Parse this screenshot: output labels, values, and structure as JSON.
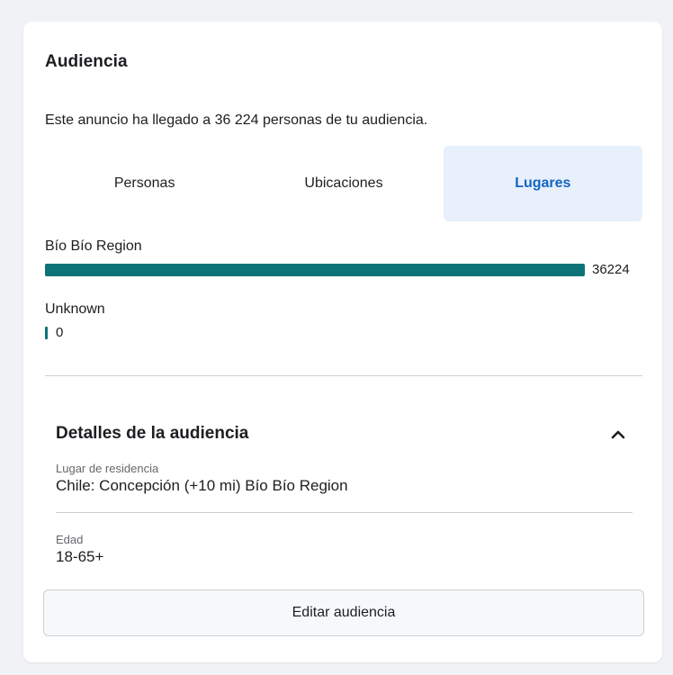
{
  "audience": {
    "title": "Audiencia",
    "reach_text": "Este anuncio ha llegado a 36 224 personas de tu audiencia."
  },
  "tabs": [
    {
      "label": "Personas",
      "active": false
    },
    {
      "label": "Ubicaciones",
      "active": false
    },
    {
      "label": "Lugares",
      "active": true
    }
  ],
  "places": [
    {
      "label": "Bío Bío Region",
      "value": "36224",
      "fraction": 1.0
    },
    {
      "label": "Unknown",
      "value": "0",
      "fraction": 0.0
    }
  ],
  "details": {
    "title": "Detalles de la audiencia",
    "toggle_icon": "chevron-up-icon",
    "residence_label": "Lugar de residencia",
    "residence_value": "Chile: Concepción (+10 mi) Bío Bío Region",
    "age_label": "Edad",
    "age_value": "18-65+"
  },
  "actions": {
    "edit_label": "Editar audiencia"
  },
  "colors": {
    "bar": "#0d7377",
    "active_tab_bg": "#e7f0fb",
    "active_tab_text": "#1565c0"
  }
}
